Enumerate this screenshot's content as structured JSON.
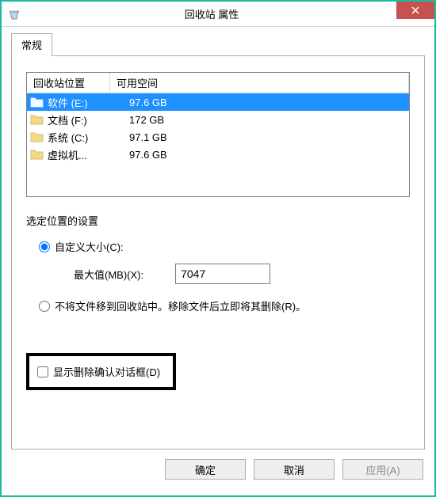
{
  "window": {
    "title": "回收站 属性"
  },
  "tabs": {
    "general": "常规"
  },
  "listview": {
    "header_location": "回收站位置",
    "header_space": "可用空间",
    "rows": [
      {
        "location": "软件 (E:)",
        "space": "97.6 GB",
        "selected": true
      },
      {
        "location": "文档 (F:)",
        "space": "172 GB",
        "selected": false
      },
      {
        "location": "系统 (C:)",
        "space": "97.1 GB",
        "selected": false
      },
      {
        "location": "虚拟机...",
        "space": "97.6 GB",
        "selected": false
      }
    ]
  },
  "settings": {
    "group_label": "选定位置的设置",
    "radio_custom": "自定义大小(C):",
    "max_label": "最大值(MB)(X):",
    "max_value": "7047",
    "radio_nomove": "不将文件移到回收站中。移除文件后立即将其删除(R)。",
    "checkbox_confirm": "显示删除确认对话框(D)"
  },
  "buttons": {
    "ok": "确定",
    "cancel": "取消",
    "apply": "应用(A)"
  }
}
